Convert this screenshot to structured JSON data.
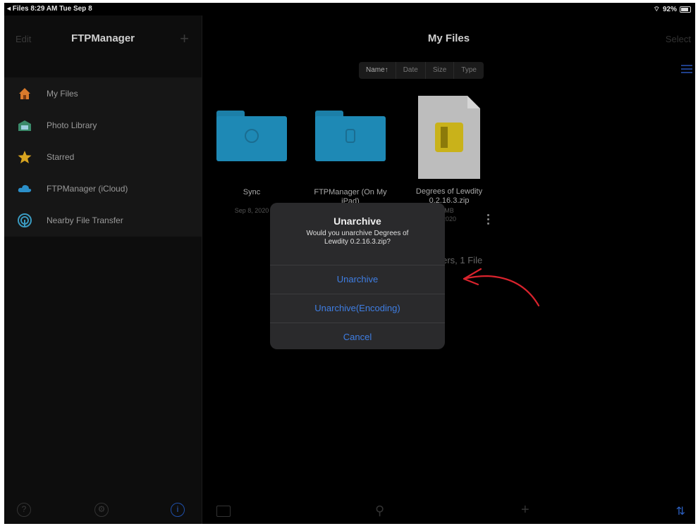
{
  "status_bar": {
    "back_app": "◂ Files",
    "time": "8:29 AM",
    "date": "Tue Sep 8",
    "battery": "92%"
  },
  "sidebar": {
    "edit_label": "Edit",
    "title": "FTPManager",
    "add_label": "+",
    "items": [
      {
        "label": "My Files",
        "icon": "house-icon"
      },
      {
        "label": "Photo Library",
        "icon": "photo-library-icon"
      },
      {
        "label": "Starred",
        "icon": "star-icon"
      },
      {
        "label": "FTPManager (iCloud)",
        "icon": "cloud-icon"
      },
      {
        "label": "Nearby File Transfer",
        "icon": "nearby-transfer-icon"
      }
    ]
  },
  "main": {
    "title": "My Files",
    "select_label": "Select",
    "sort": [
      "Name↑",
      "Date",
      "Size",
      "Type"
    ],
    "files": [
      {
        "name": "Sync",
        "date": "Sep 8, 2020",
        "kind": "folder"
      },
      {
        "name": "FTPManager (On My iPad)",
        "date": "",
        "kind": "folder"
      },
      {
        "name": "Degrees of Lewdity 0.2.16.3.zip",
        "size": "MB",
        "date": "2020",
        "kind": "zip"
      }
    ],
    "count_label": "lders, 1 File"
  },
  "dialog": {
    "title": "Unarchive",
    "message": "Would you unarchive Degrees of Lewdity 0.2.16.3.zip?",
    "buttons": [
      "Unarchive",
      "Unarchive(Encoding)",
      "Cancel"
    ]
  },
  "colors": {
    "accent": "#3f7ee3",
    "folder": "#1e89b5",
    "annotation": "#d9232d"
  }
}
